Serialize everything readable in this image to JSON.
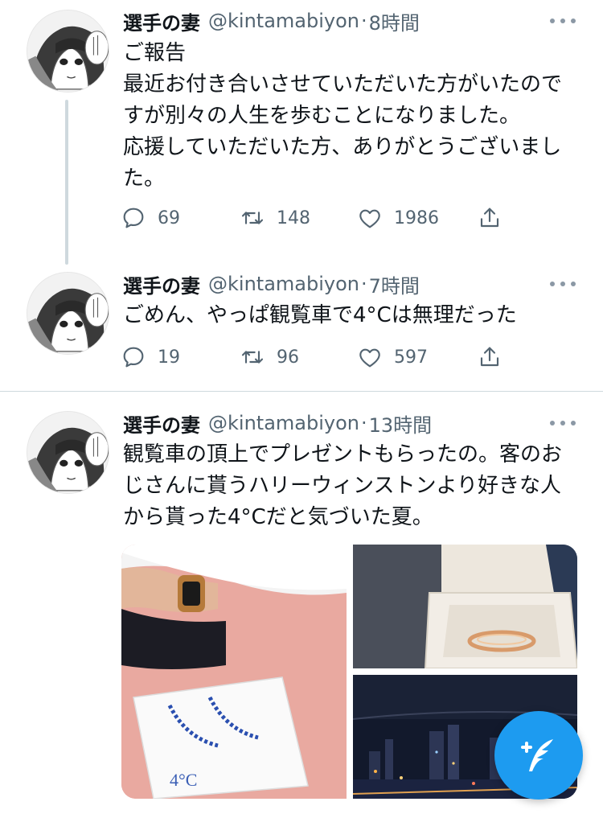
{
  "colors": {
    "accent": "#1d9bf0",
    "text_primary": "#0f1419",
    "text_secondary": "#536471"
  },
  "tweets": [
    {
      "name": "選手の妻",
      "handle": "@kintamabiyon",
      "separator": "·",
      "time": "8時間",
      "text": "ご報告\n最近お付き合いさせていただいた方がいたのですが別々の人生を歩むことになりました。\n応援していただいた方、ありがとうございました。",
      "replies": "69",
      "retweets": "148",
      "likes": "1986"
    },
    {
      "name": "選手の妻",
      "handle": "@kintamabiyon",
      "separator": "·",
      "time": "7時間",
      "text": "ごめん、やっぱ観覧車で4°Cは無理だった",
      "replies": "19",
      "retweets": "96",
      "likes": "597"
    },
    {
      "name": "選手の妻",
      "handle": "@kintamabiyon",
      "separator": "·",
      "time": "13時間",
      "text": "観覧車の頂上でプレゼントもらったの。客のおじさんに貰うハリーウィンストンより好きな人から貰った4°Cだと気づいた夏。",
      "media": {
        "bag_logo": "4°C"
      }
    }
  ],
  "icons": {
    "reply": "reply-icon",
    "retweet": "retweet-icon",
    "like": "heart-icon",
    "share": "share-icon",
    "more": "more-icon",
    "compose": "compose-tweet-icon"
  }
}
